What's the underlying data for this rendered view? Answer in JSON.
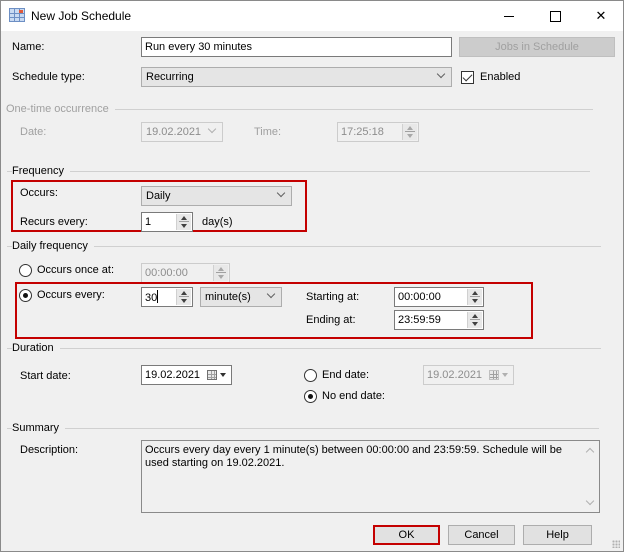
{
  "window": {
    "title": "New Job Schedule",
    "icon": "calendar-grid-icon",
    "controls": {
      "minimize": "minimize-icon",
      "maximize": "maximize-icon",
      "close": "close-icon"
    }
  },
  "name": {
    "label": "Name:",
    "value": "Run every 30 minutes"
  },
  "jobs_in_schedule_button": "Jobs in Schedule",
  "schedule_type": {
    "label": "Schedule type:",
    "value": "Recurring"
  },
  "enabled": {
    "label": "Enabled",
    "checked": true
  },
  "one_time": {
    "title": "One-time occurrence",
    "date_label": "Date:",
    "date_value": "19.02.2021",
    "time_label": "Time:",
    "time_value": "17:25:18"
  },
  "frequency": {
    "title": "Frequency",
    "occurs_label": "Occurs:",
    "occurs_value": "Daily",
    "recurs_label": "Recurs every:",
    "recurs_value": "1",
    "recurs_unit": "day(s)"
  },
  "daily_frequency": {
    "title": "Daily frequency",
    "once_label": "Occurs once at:",
    "once_value": "00:00:00",
    "once_selected": false,
    "every_label": "Occurs every:",
    "every_value": "30",
    "every_selected": true,
    "every_unit": "minute(s)",
    "starting_label": "Starting at:",
    "starting_value": "00:00:00",
    "ending_label": "Ending at:",
    "ending_value": "23:59:59"
  },
  "duration": {
    "title": "Duration",
    "start_label": "Start date:",
    "start_value": "19.02.2021",
    "end_date_label": "End date:",
    "end_date_value": "19.02.2021",
    "end_date_selected": false,
    "no_end_label": "No end date:",
    "no_end_selected": true
  },
  "summary": {
    "title": "Summary",
    "description_label": "Description:",
    "description": "Occurs every day every 1 minute(s) between 00:00:00 and 23:59:59. Schedule will be used starting on 19.02.2021."
  },
  "buttons": {
    "ok": "OK",
    "cancel": "Cancel",
    "help": "Help"
  },
  "colors": {
    "highlight": "#c40000",
    "background": "#f0f0f0"
  }
}
